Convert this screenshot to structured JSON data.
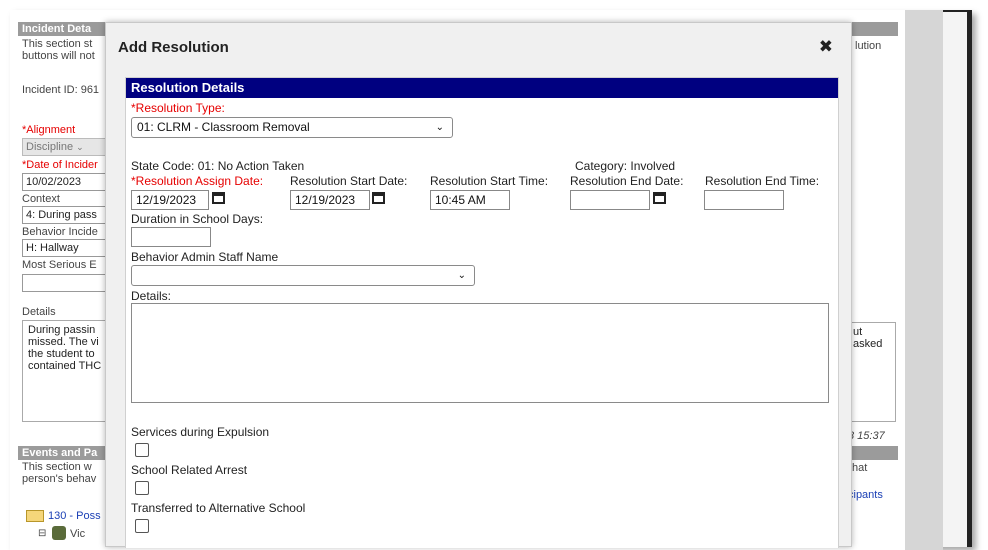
{
  "background": {
    "incident_header": "Incident Deta",
    "section_note_1": "This section st",
    "section_note_2": "buttons will not",
    "right_fragment_1": "lution",
    "incident_id": "Incident ID: 961",
    "alignment_label": "*Alignment",
    "alignment_value": "Discipline",
    "date_label": "*Date of Incider",
    "date_value": "10/02/2023",
    "context_label": "Context",
    "context_value": "4: During pass",
    "behavior_label": "Behavior Incide",
    "behavior_value": "H: Hallway",
    "most_serious_label": "Most Serious E",
    "details_label": "Details",
    "details_lines": [
      "During passin",
      "missed. The vi",
      "the student to",
      "contained THC"
    ],
    "right_detail_1": "ut",
    "right_detail_2": "asked",
    "timestamp_fragment": "3 15:37",
    "events_header": "Events and Pa",
    "events_note_1": "This section w",
    "events_note_2": "person's behav",
    "right_fragment_2": "hat",
    "participants_link": "cipants",
    "tree_item": "130 - Poss",
    "tree_subitem": "Vic"
  },
  "modal": {
    "title": "Add Resolution",
    "close_glyph": "✖",
    "section_title": "Resolution Details",
    "resolution_type_label": "*Resolution Type:",
    "resolution_type_value": "01: CLRM - Classroom Removal",
    "state_code": "State Code: 01: No Action Taken",
    "category": "Category: Involved",
    "assign_date_label": "*Resolution Assign Date:",
    "assign_date_value": "12/19/2023",
    "start_date_label": "Resolution Start Date:",
    "start_date_value": "12/19/2023",
    "start_time_label": "Resolution Start Time:",
    "start_time_value": "10:45 AM",
    "end_date_label": "Resolution End Date:",
    "end_date_value": "",
    "end_time_label": "Resolution End Time:",
    "end_time_value": "",
    "duration_label": "Duration in School Days:",
    "duration_value": "",
    "staff_label": "Behavior Admin Staff Name",
    "staff_value": "",
    "details_label": "Details:",
    "details_value": "",
    "services_label": "Services during Expulsion",
    "arrest_label": "School Related Arrest",
    "transferred_label": "Transferred to Alternative School"
  },
  "colors": {
    "section_bar": "#000080",
    "required_label": "#e60000",
    "link": "#1a3fb5"
  },
  "icons": [
    "close-icon",
    "calendar-icon",
    "chevron-down-icon",
    "folder-icon",
    "person-icon"
  ]
}
